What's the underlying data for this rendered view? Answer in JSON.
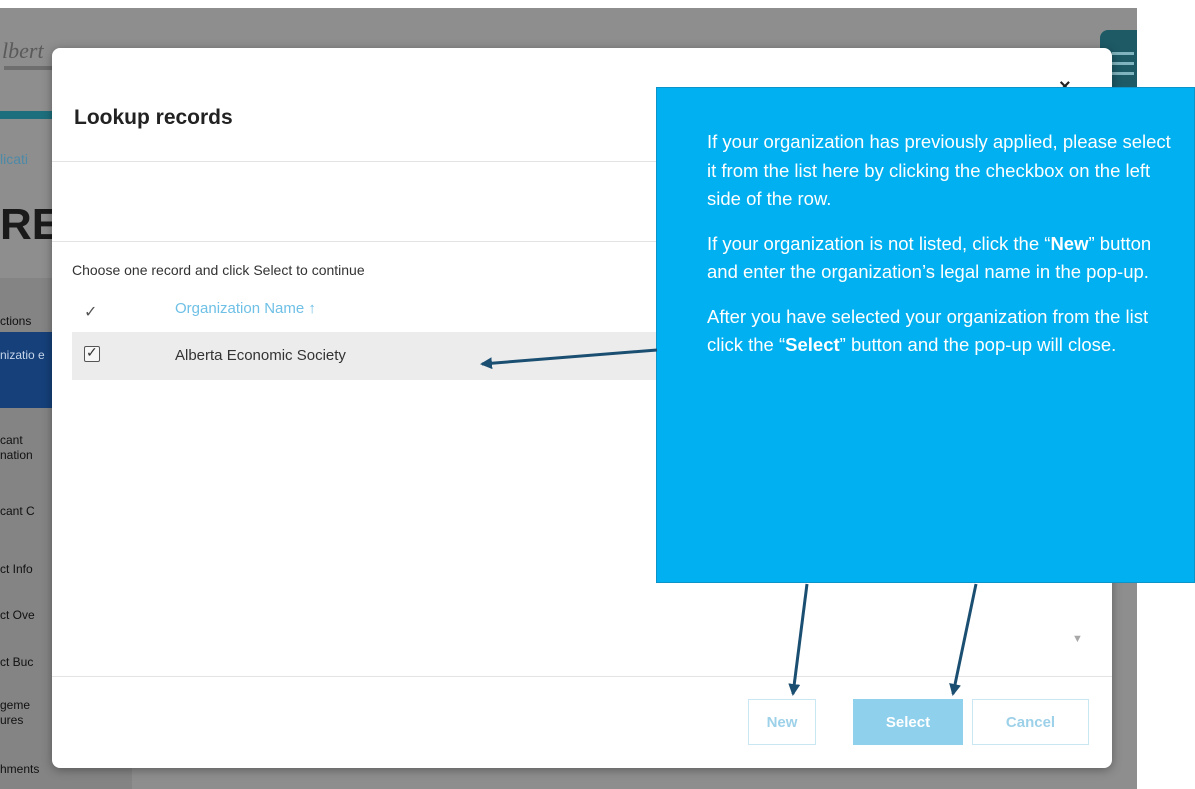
{
  "background": {
    "logo_text": "lbert",
    "breadcrumb": "licati",
    "heading": "RE",
    "sidebar_items": [
      "ctions",
      "nizatio e",
      "cant nation",
      "cant C",
      "ct Info",
      "ct Ove",
      "ct Buc",
      "geme ures",
      "hments"
    ]
  },
  "modal": {
    "title": "Lookup records",
    "close_glyph": "×",
    "instruction": "Choose one record and click Select to continue",
    "column_header": "Organization Name ↑",
    "header_check_glyph": "✓",
    "rows": [
      {
        "name": "Alberta Economic Society",
        "checked": true
      }
    ],
    "scroll_glyph": "▼",
    "buttons": {
      "new": "New",
      "select": "Select",
      "cancel": "Cancel"
    }
  },
  "callout": {
    "p1": "If your organization has previously applied, please select it from the list here by clicking the checkbox on the left side of the row.",
    "p2_before": "If your organization is not listed, click the “",
    "p2_bold": "New",
    "p2_after": "” button and enter the organization’s legal name in the pop-up.",
    "p3_before": "After you have selected your organization from the list click the “",
    "p3_bold": "Select",
    "p3_after": "” button and the pop-up will close."
  },
  "colors": {
    "callout_bg": "#00b0f0",
    "arrow": "#1b4f72",
    "link_blue": "#6ec0e6",
    "button_primary": "#8fd0ec"
  }
}
